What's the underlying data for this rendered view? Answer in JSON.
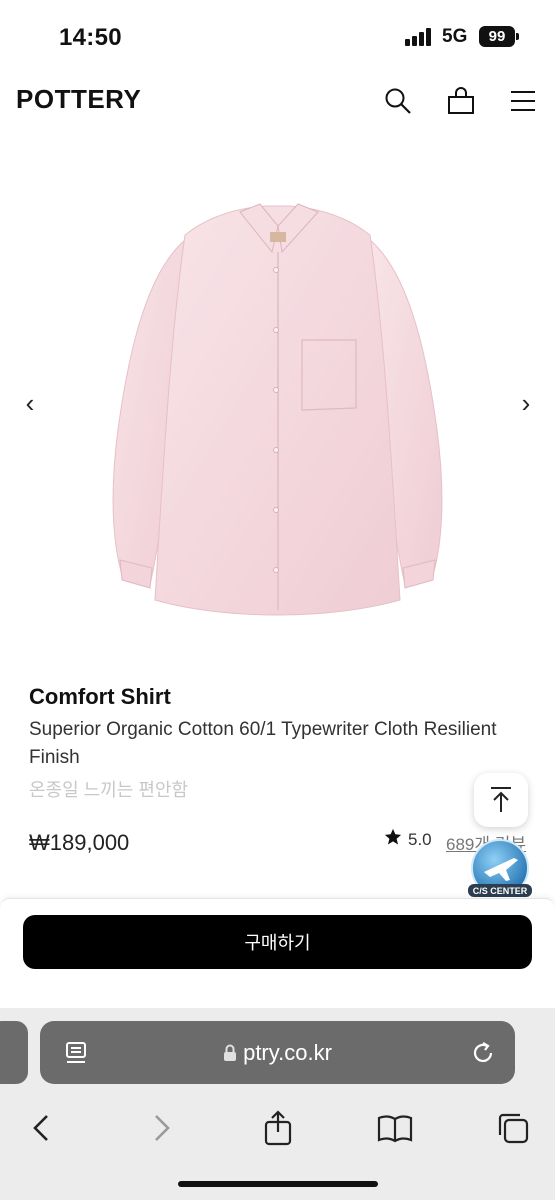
{
  "status": {
    "time": "14:50",
    "network": "5G",
    "battery": "99"
  },
  "header": {
    "logo": "POTTERY",
    "icons": [
      "search-icon",
      "bag-icon",
      "menu-icon"
    ]
  },
  "gallery": {
    "prev": "‹",
    "next": "›"
  },
  "product": {
    "name": "Comfort Shirt",
    "description": "Superior Organic Cotton 60/1 Typewriter Cloth Resilient Finish",
    "tagline": "온종일 느끼는 편안함",
    "price": "₩189,000",
    "rating": "5.0",
    "reviews": "689개 리뷰"
  },
  "floating": {
    "cs_label": "C/S CENTER"
  },
  "buy": {
    "label": "구매하기"
  },
  "browser": {
    "url": "ptry.co.kr"
  },
  "colors": {
    "accent": "#000000",
    "shirt": "#f4d8de",
    "url_bar": "#6b6b6b"
  }
}
